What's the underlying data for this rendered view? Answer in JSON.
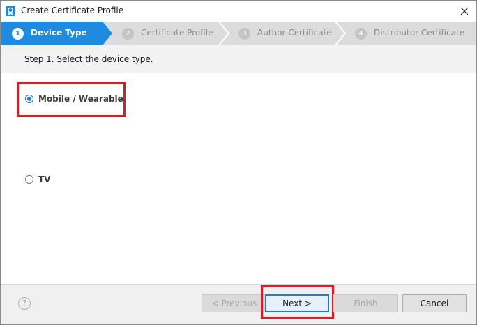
{
  "window": {
    "title": "Create Certificate Profile"
  },
  "steps": [
    {
      "number": "1",
      "label": "Device Type"
    },
    {
      "number": "2",
      "label": "Certificate Profile"
    },
    {
      "number": "3",
      "label": "Author Certificate"
    },
    {
      "number": "4",
      "label": "Distributor Certificate"
    }
  ],
  "step_description": "Step 1. Select the device type.",
  "options": [
    {
      "label": "Mobile / Wearable",
      "selected": true
    },
    {
      "label": "TV",
      "selected": false
    }
  ],
  "buttons": {
    "help": "?",
    "previous": "< Previous",
    "next": "Next >",
    "finish": "Finish",
    "cancel": "Cancel"
  },
  "colors": {
    "accent": "#1e8be0",
    "highlight": "#e01b22"
  }
}
